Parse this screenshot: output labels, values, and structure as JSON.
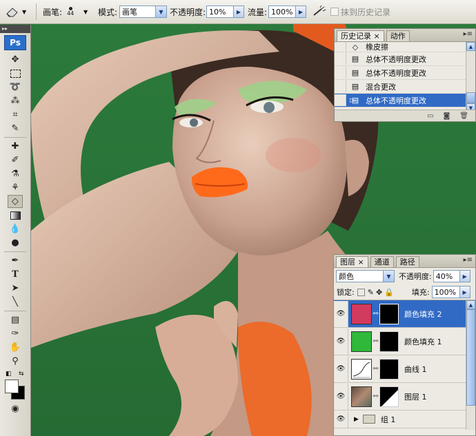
{
  "options_bar": {
    "brush_label": "画笔:",
    "brush_size": "44",
    "mode_label": "模式:",
    "mode_value": "画笔",
    "opacity_label": "不透明度:",
    "opacity_value": "10%",
    "flow_label": "流量:",
    "flow_value": "100%",
    "erase_history_label": "抹到历史记录"
  },
  "toolbox": {
    "logo": "Ps"
  },
  "history_panel": {
    "tabs": [
      "历史记录",
      "动作"
    ],
    "items": [
      {
        "label": "橡皮擦",
        "icon": "eraser-icon"
      },
      {
        "label": "总体不透明度更改",
        "icon": "history-state-icon"
      },
      {
        "label": "总体不透明度更改",
        "icon": "history-state-icon"
      },
      {
        "label": "混合更改",
        "icon": "history-state-icon"
      },
      {
        "label": "总体不透明度更改",
        "icon": "history-state-icon",
        "selected": true
      }
    ]
  },
  "layers_panel": {
    "tabs": [
      "图层",
      "通道",
      "路径"
    ],
    "blend_mode": "颜色",
    "opacity_label": "不透明度:",
    "opacity_value": "40%",
    "lock_label": "锁定:",
    "fill_label": "填充:",
    "fill_value": "100%",
    "layers": [
      {
        "name": "颜色填充 2",
        "thumb_color": "#d23a5e",
        "selected": true
      },
      {
        "name": "颜色填充 1",
        "thumb_color": "#2fb83a",
        "selected": false
      },
      {
        "name": "曲线 1",
        "thumb_color": "#ffffff",
        "selected": false
      },
      {
        "name": "图层 1",
        "thumb_color": "#7a6a5a",
        "selected": false
      },
      {
        "name": "组 1",
        "thumb_color": "",
        "selected": false
      }
    ]
  },
  "colors": {
    "background_green": "#2f7a3e",
    "selection_blue": "#316ac5",
    "lip_orange": "#ff6a1a"
  }
}
